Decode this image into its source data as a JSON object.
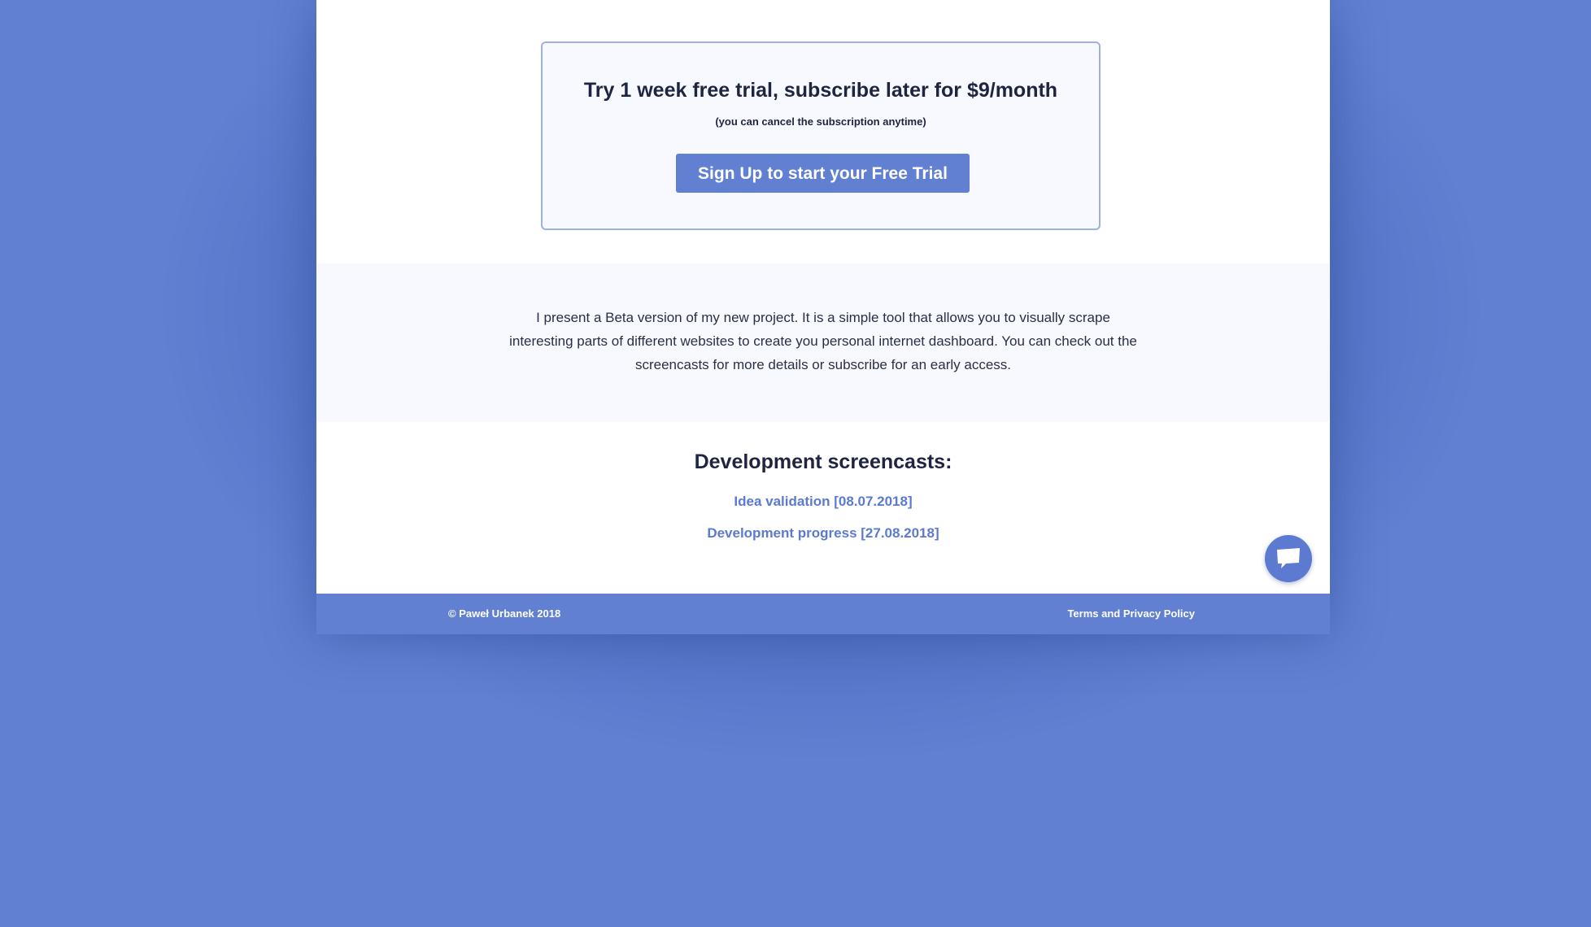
{
  "trial": {
    "title": "Try 1 week free trial, subscribe later for $9/month",
    "note": "(you can cancel the subscription anytime)",
    "button_label": "Sign Up to start your Free Trial"
  },
  "intro": {
    "text": "I present a Beta version of my new project. It is a simple tool that allows you to visually scrape interesting parts of different websites to create you personal internet dashboard. You can check out the screencasts for more details or subscribe for an early access."
  },
  "screencasts": {
    "title": "Development screencasts:",
    "links": [
      {
        "label": "Idea validation [08.07.2018]"
      },
      {
        "label": "Development progress [27.08.2018]"
      }
    ]
  },
  "chat": {
    "icon": "chat-bubble-icon"
  },
  "footer": {
    "copyright": "© Paweł Urbanek 2018",
    "terms_label": "Terms and Privacy Policy"
  },
  "colors": {
    "background": "#6080d2",
    "accent": "#6180d2",
    "link": "#5b7ad0",
    "panel": "#f7f9fe"
  }
}
